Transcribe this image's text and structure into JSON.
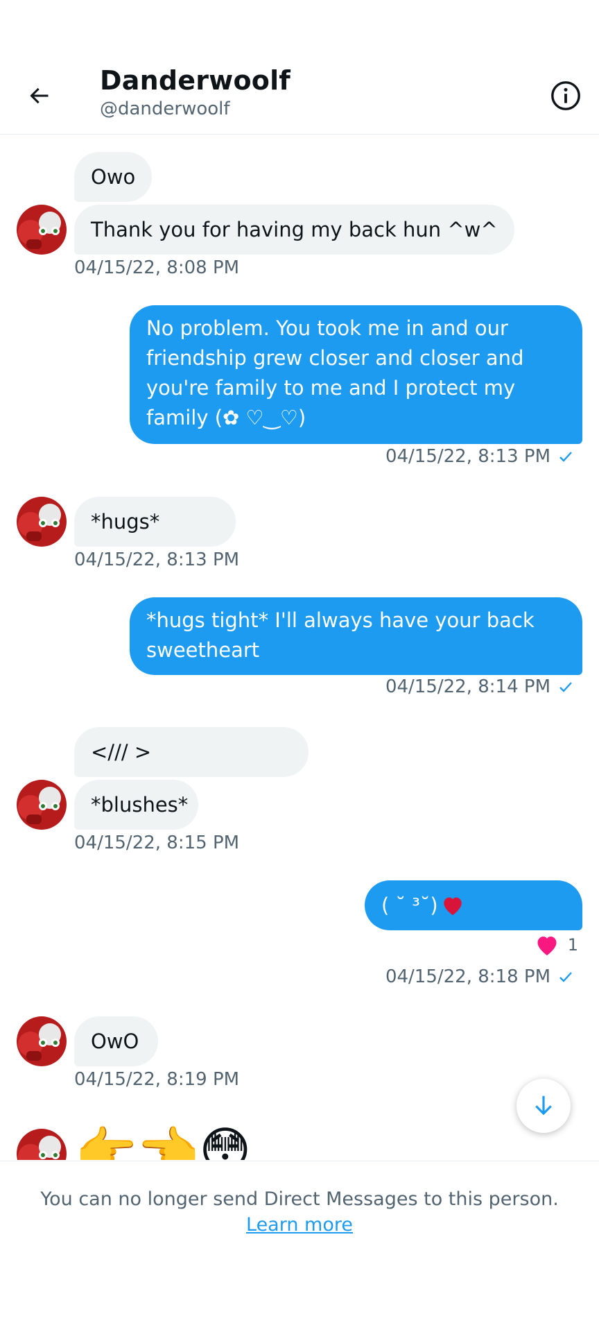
{
  "header": {
    "title": "Danderwoolf",
    "handle": "@danderwoolf",
    "back_icon": "arrow-left-icon",
    "info_icon": "info-circle-icon"
  },
  "messages": [
    {
      "from": "them",
      "text": "Owo"
    },
    {
      "from": "them",
      "text": "Thank you for having my back hun ^w^"
    },
    {
      "from": "them",
      "timestamp": "04/15/22, 8:08 PM"
    },
    {
      "from": "me",
      "text": "No problem. You took me in and our friendship grew closer and closer and you're family to me and I protect my family (✿ ♡‿♡)",
      "timestamp": "04/15/22, 8:13 PM"
    },
    {
      "from": "them",
      "text": "*hugs*",
      "timestamp": "04/15/22, 8:13 PM"
    },
    {
      "from": "me",
      "text": "*hugs tight* I'll always have your back sweetheart",
      "timestamp": "04/15/22, 8:14 PM"
    },
    {
      "from": "them",
      "text": "</// >"
    },
    {
      "from": "them",
      "text": "*blushes*",
      "timestamp": "04/15/22, 8:15 PM"
    },
    {
      "from": "me",
      "text": "( ˘ ³˘)",
      "timestamp": "04/15/22, 8:18 PM",
      "reaction_count": "1"
    },
    {
      "from": "them",
      "text": "OwO",
      "timestamp": "04/15/22, 8:19 PM"
    },
    {
      "from": "them",
      "emoji": "👉👈😳"
    }
  ],
  "footer": {
    "text": "You can no longer send Direct Messages to this person.",
    "link": "Learn more"
  },
  "colors": {
    "accent": "#1d9bf0",
    "incoming_bubble": "#eff3f4",
    "heart": "#f91880"
  }
}
